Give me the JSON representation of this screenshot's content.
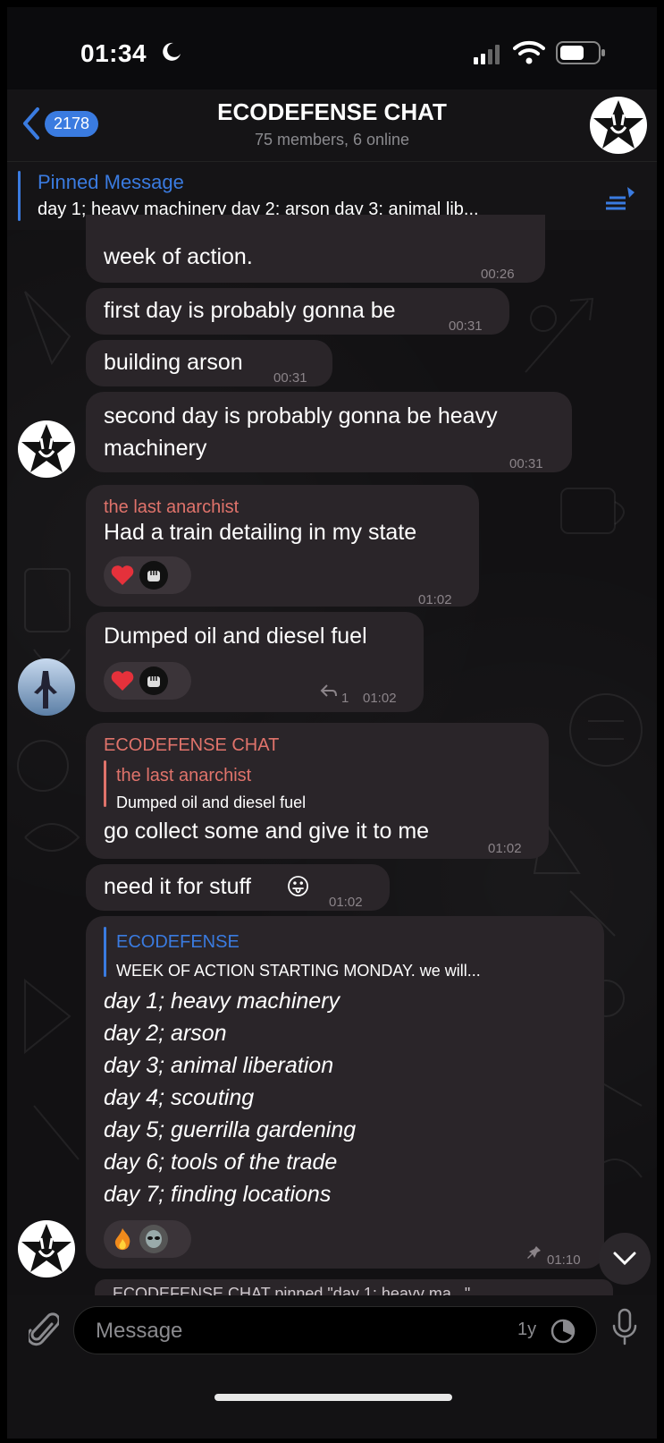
{
  "status_bar": {
    "time": "01:34"
  },
  "header": {
    "back_count": "2178",
    "title": "ECODEFENSE CHAT",
    "subtitle": "75 members, 6 online"
  },
  "pinned": {
    "label": "Pinned Message",
    "text": "day 1; heavy machinery day 2; arson day 3; animal lib..."
  },
  "messages": [
    {
      "text": "week of action.",
      "time": "00:26"
    },
    {
      "text": "first day is probably gonna be",
      "time": "00:31"
    },
    {
      "text": "building arson",
      "time": "00:31"
    },
    {
      "line1": "second day is probably gonna be heavy",
      "line2": "machinery",
      "time": "00:31"
    },
    {
      "sender": "the last anarchist",
      "text": "Had a train detailing in my state",
      "time": "01:02"
    },
    {
      "text": "Dumped oil and diesel fuel",
      "replies": "1",
      "time": "01:02"
    },
    {
      "sender": "ECODEFENSE CHAT",
      "reply_name": "the last anarchist",
      "reply_text": "Dumped oil and diesel fuel",
      "text": "go collect some and give it to me",
      "time": "01:02"
    },
    {
      "text": "need it for stuff",
      "emoji": "😛",
      "time": "01:02"
    },
    {
      "reply_name": "ECODEFENSE",
      "reply_text": "WEEK OF ACTION STARTING MONDAY. we will...",
      "lines": [
        "day 1; heavy machinery",
        "day 2; arson",
        "day 3; animal liberation",
        "day 4; scouting",
        "day 5; guerrilla gardening",
        "day 6; tools of the trade",
        "day 7; finding locations"
      ],
      "time": "01:10"
    }
  ],
  "service_message": "ECODEFENSE CHAT pinned \"day 1; heavy ma...\"",
  "input": {
    "placeholder": "Message",
    "timer": "1y"
  },
  "colors": {
    "accent": "#3a7be0",
    "sender": "#e0736b",
    "bubble": "#2a2529"
  }
}
